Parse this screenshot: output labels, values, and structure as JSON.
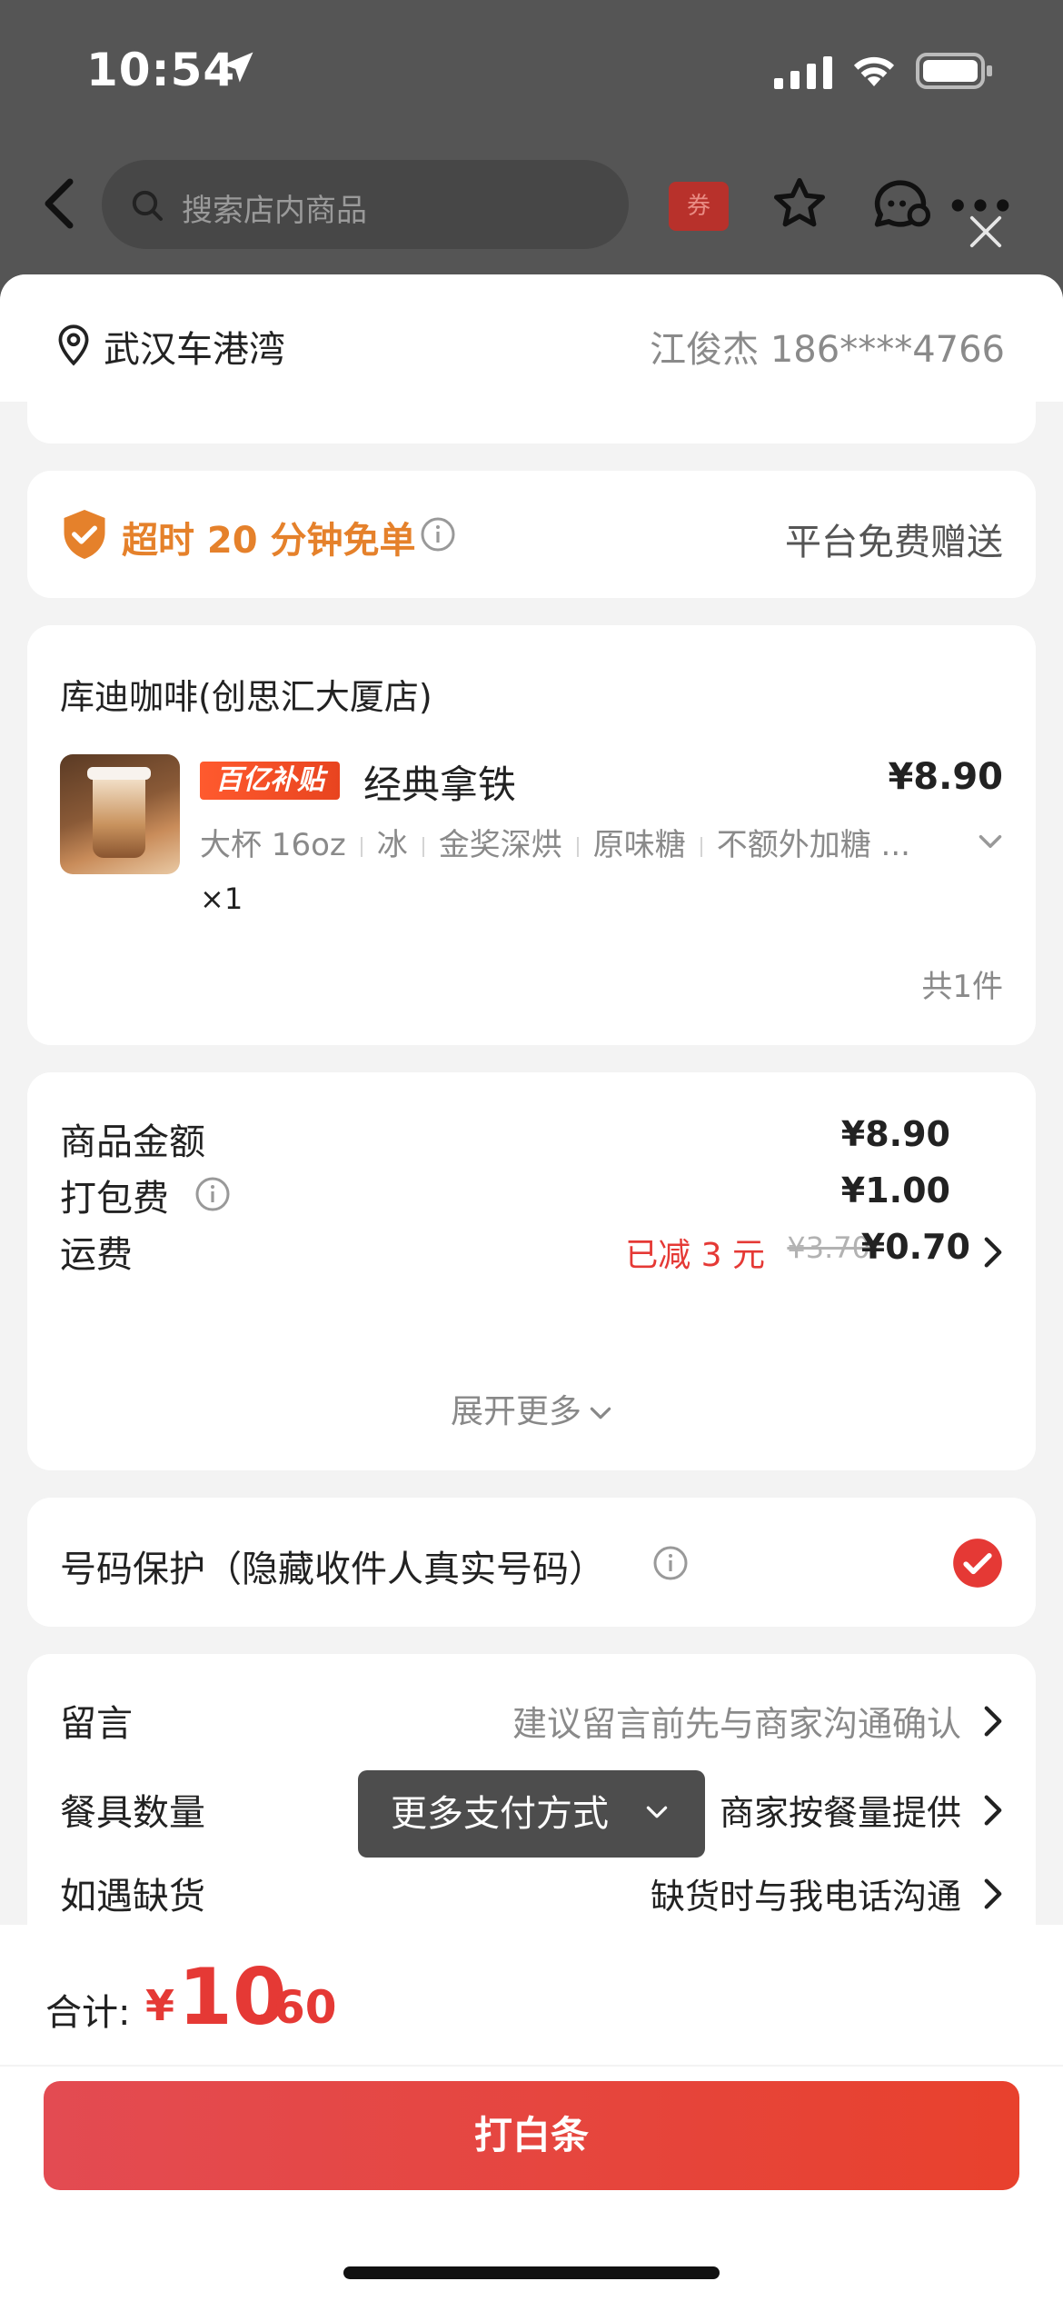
{
  "status_bar": {
    "time": "10:54"
  },
  "nav": {
    "search_placeholder": "搜索店内商品",
    "coupon_label": "券"
  },
  "address": {
    "location": "武汉车港湾",
    "contact": "江俊杰 186****4766"
  },
  "guarantee": {
    "title": "超时 20 分钟免单",
    "right_text": "平台免费赠送"
  },
  "store": {
    "name": "库迪咖啡(创思汇大厦店)",
    "badge": "百亿补贴",
    "product_name": "经典拿铁",
    "product_price": "¥8.90",
    "specs": [
      "大杯 16oz",
      "冰",
      "金奖深烘",
      "原味糖",
      "不额外加糖 ..."
    ],
    "quantity": "×1",
    "item_count": "共1件"
  },
  "fees": {
    "goods_label": "商品金额",
    "goods_value": "¥8.90",
    "packing_label": "打包费",
    "packing_value": "¥1.00",
    "delivery_label": "运费",
    "delivery_discount": "已减 3 元",
    "delivery_original": "¥3.70",
    "delivery_value": "¥0.70",
    "expand_more": "展开更多"
  },
  "privacy": {
    "label": "号码保护（隐藏收件人真实号码）",
    "checked": true
  },
  "notes": {
    "remark_label": "留言",
    "remark_value": "建议留言前先与商家沟通确认",
    "tableware_label": "餐具数量",
    "tableware_value": "商家按餐量提供",
    "stockout_label": "如遇缺货",
    "stockout_value": "缺货时与我电话沟通"
  },
  "pay_tooltip": "更多支付方式",
  "footer": {
    "total_label": "合计:",
    "currency": "¥",
    "total_integer": "10",
    "total_decimal": ".60",
    "pay_button": "打白条"
  },
  "colors": {
    "accent_red": "#e53935",
    "guarantee_orange": "#e5812b",
    "button_gradient_start": "#e34b52",
    "button_gradient_end": "#e8412d"
  }
}
